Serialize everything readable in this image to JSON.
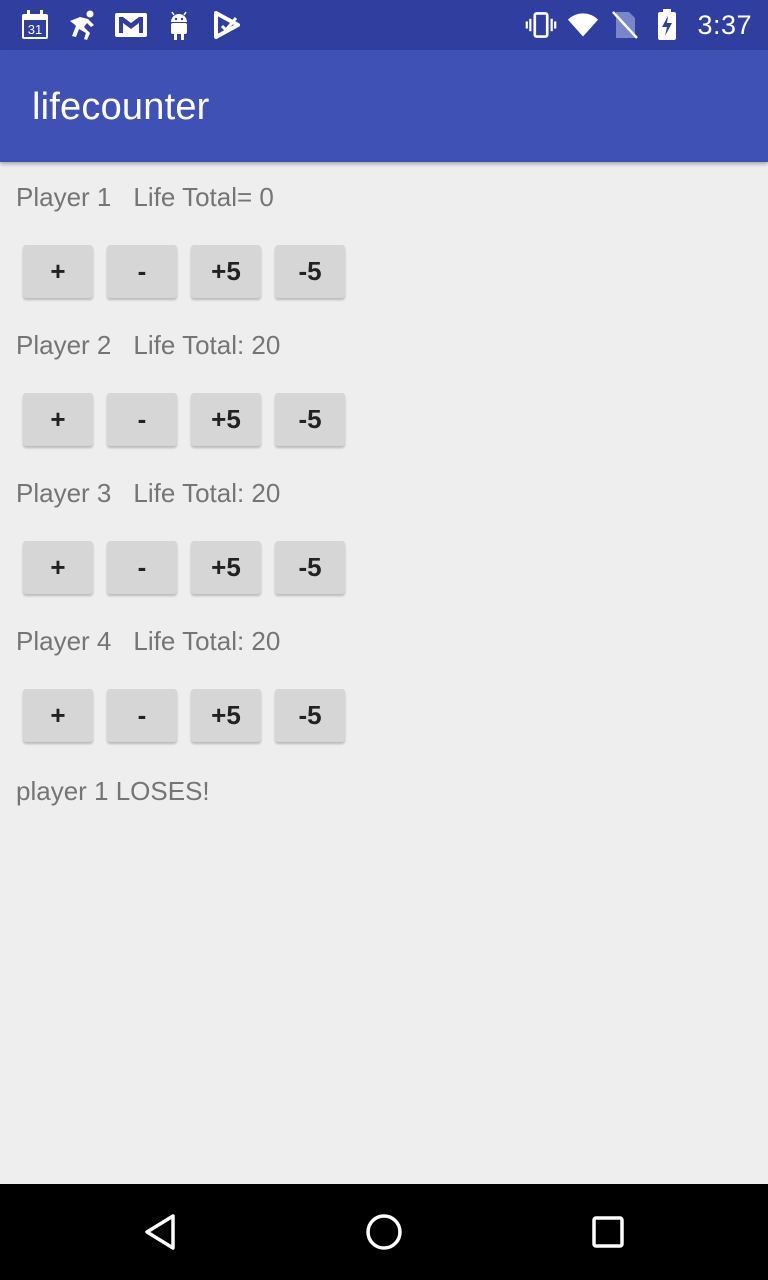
{
  "status_bar": {
    "time": "3:37",
    "calendar_day": "31",
    "left_icons": [
      "calendar-icon",
      "runner-icon",
      "gmail-icon",
      "android-icon",
      "play-store-icon"
    ],
    "right_icons": [
      "vibrate-icon",
      "wifi-icon",
      "no-sim-icon",
      "battery-charging-icon"
    ]
  },
  "app_bar": {
    "title": "lifecounter"
  },
  "players": [
    {
      "name": "Player 1",
      "life": "Life Total= 0"
    },
    {
      "name": "Player 2",
      "life": "Life Total: 20"
    },
    {
      "name": "Player 3",
      "life": "Life Total: 20"
    },
    {
      "name": "Player 4",
      "life": "Life Total: 20"
    }
  ],
  "buttons": {
    "plus": "+",
    "minus": "-",
    "plus5": "+5",
    "minus5": "-5"
  },
  "result_text": "player 1 LOSES!",
  "colors": {
    "status_bar": "#303f9f",
    "app_bar": "#3f51b5",
    "background": "#eeeeee",
    "button": "#d6d6d6"
  },
  "nav_bar": {
    "icons": [
      "back-icon",
      "home-icon",
      "recents-icon"
    ]
  }
}
